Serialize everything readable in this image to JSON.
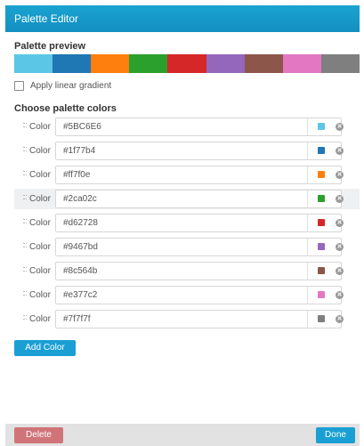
{
  "window": {
    "title": "Palette Editor"
  },
  "preview": {
    "label": "Palette preview",
    "swatches": [
      "#5BC6E6",
      "#1f77b4",
      "#ff7f0e",
      "#2ca02c",
      "#d62728",
      "#9467bd",
      "#8c564b",
      "#e377c2",
      "#7f7f7f"
    ]
  },
  "gradient": {
    "label": "Apply linear gradient",
    "checked": false
  },
  "colors": {
    "label": "Choose palette colors",
    "rows": [
      {
        "label": "Color",
        "value": "#5BC6E6",
        "chip": "#5BC6E6"
      },
      {
        "label": "Color",
        "value": "#1f77b4",
        "chip": "#1f77b4"
      },
      {
        "label": "Color",
        "value": "#ff7f0e",
        "chip": "#ff7f0e"
      },
      {
        "label": "Color",
        "value": "#2ca02c",
        "chip": "#2ca02c"
      },
      {
        "label": "Color",
        "value": "#d62728",
        "chip": "#d62728"
      },
      {
        "label": "Color",
        "value": "#9467bd",
        "chip": "#9467bd"
      },
      {
        "label": "Color",
        "value": "#8c564b",
        "chip": "#8c564b"
      },
      {
        "label": "Color",
        "value": "#e377c2",
        "chip": "#e377c2"
      },
      {
        "label": "Color",
        "value": "#7f7f7f",
        "chip": "#7f7f7f"
      }
    ]
  },
  "buttons": {
    "add": "Add Color",
    "delete": "Delete",
    "done": "Done"
  },
  "icons": {
    "drag": "drag-handle-icon",
    "remove": "remove-circle-icon"
  }
}
